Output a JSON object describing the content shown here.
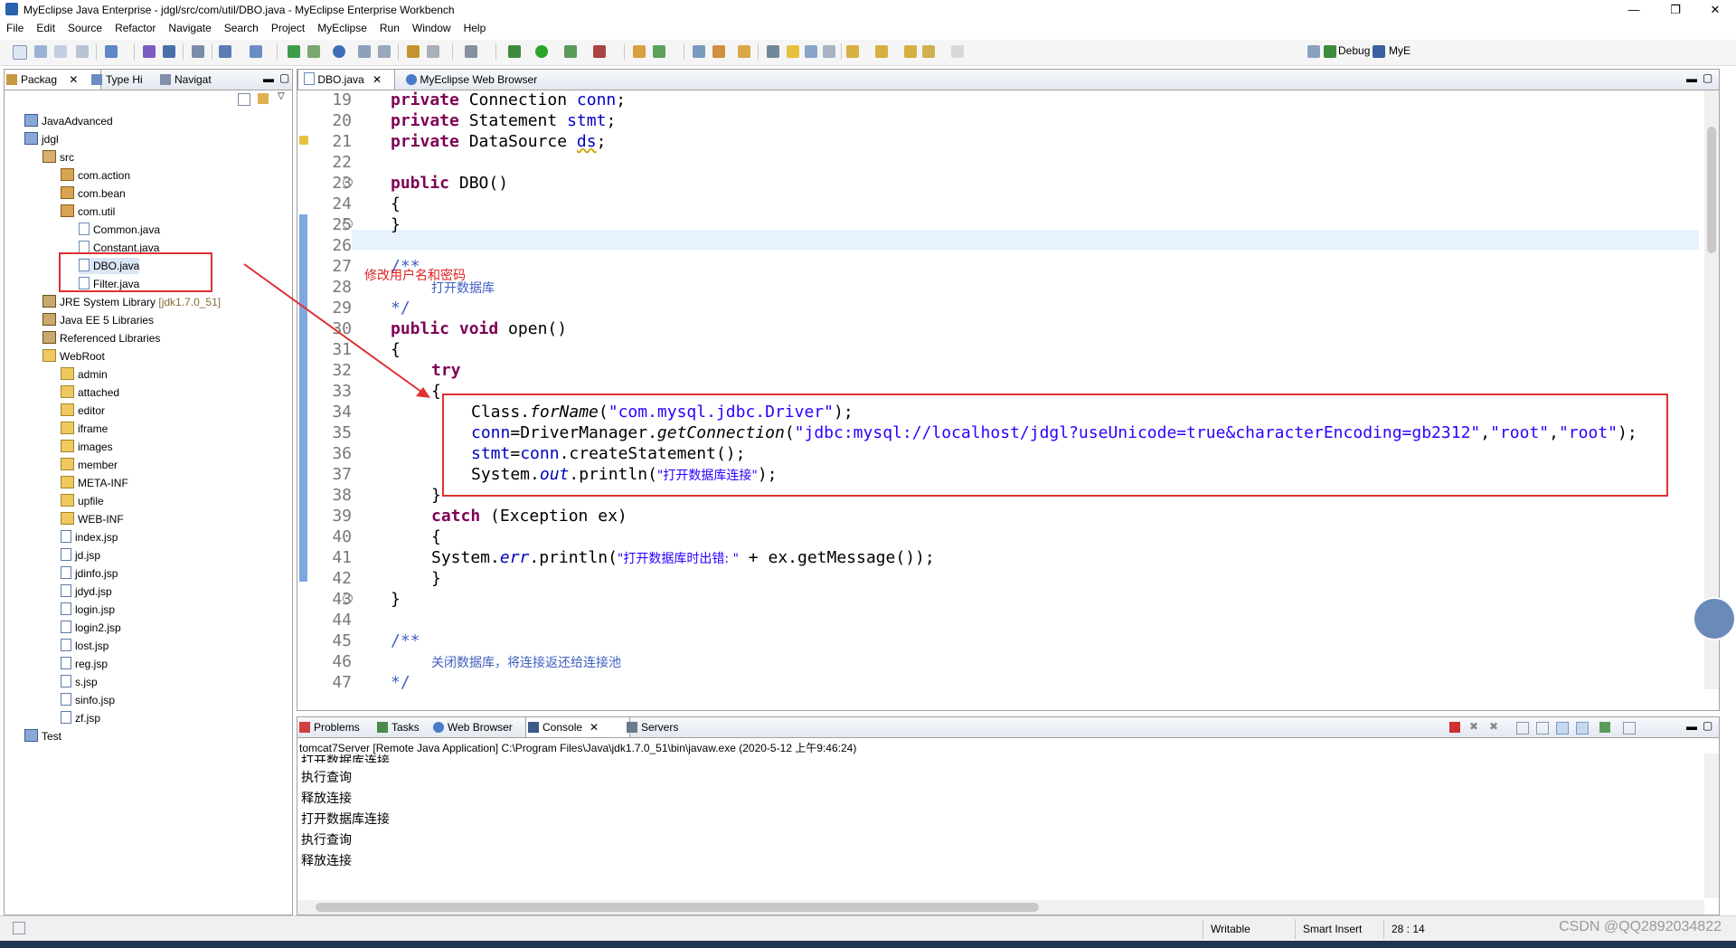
{
  "window": {
    "title": "MyEclipse Java Enterprise - jdgl/src/com/util/DBO.java - MyEclipse Enterprise Workbench",
    "minimize": "—",
    "maximize": "❐",
    "close": "✕"
  },
  "menu": [
    "File",
    "Edit",
    "Source",
    "Refactor",
    "Navigate",
    "Search",
    "Project",
    "MyEclipse",
    "Run",
    "Window",
    "Help"
  ],
  "perspectives": {
    "debug": "Debug",
    "myeclipse": "MyE"
  },
  "left_panel": {
    "tabs": [
      "Packag",
      "Type Hi",
      "Navigat"
    ],
    "tree": [
      {
        "label": "JavaAdvanced",
        "icon": "project"
      },
      {
        "label": "jdgl",
        "icon": "project"
      },
      {
        "label": "src",
        "icon": "src-folder"
      },
      {
        "label": "com.action",
        "icon": "package"
      },
      {
        "label": "com.bean",
        "icon": "package"
      },
      {
        "label": "com.util",
        "icon": "package"
      },
      {
        "label": "Common.java",
        "icon": "java-file"
      },
      {
        "label": "Constant.java",
        "icon": "java-file"
      },
      {
        "label": "DBO.java",
        "icon": "java-file"
      },
      {
        "label": "Filter.java",
        "icon": "java-file"
      },
      {
        "label": "JRE System Library",
        "decoration": "[jdk1.7.0_51]",
        "icon": "library"
      },
      {
        "label": "Java EE 5 Libraries",
        "icon": "library"
      },
      {
        "label": "Referenced Libraries",
        "icon": "library"
      },
      {
        "label": "WebRoot",
        "icon": "folder"
      },
      {
        "label": "admin",
        "icon": "folder"
      },
      {
        "label": "attached",
        "icon": "folder"
      },
      {
        "label": "editor",
        "icon": "folder"
      },
      {
        "label": "iframe",
        "icon": "folder"
      },
      {
        "label": "images",
        "icon": "folder"
      },
      {
        "label": "member",
        "icon": "folder"
      },
      {
        "label": "META-INF",
        "icon": "folder"
      },
      {
        "label": "upfile",
        "icon": "folder"
      },
      {
        "label": "WEB-INF",
        "icon": "folder"
      },
      {
        "label": "index.jsp",
        "icon": "jsp-file"
      },
      {
        "label": "jd.jsp",
        "icon": "jsp-file"
      },
      {
        "label": "jdinfo.jsp",
        "icon": "jsp-file"
      },
      {
        "label": "jdyd.jsp",
        "icon": "jsp-file"
      },
      {
        "label": "login.jsp",
        "icon": "jsp-file"
      },
      {
        "label": "login2.jsp",
        "icon": "jsp-file"
      },
      {
        "label": "lost.jsp",
        "icon": "jsp-file"
      },
      {
        "label": "reg.jsp",
        "icon": "jsp-file"
      },
      {
        "label": "s.jsp",
        "icon": "jsp-file"
      },
      {
        "label": "sinfo.jsp",
        "icon": "jsp-file"
      },
      {
        "label": "zf.jsp",
        "icon": "jsp-file"
      },
      {
        "label": "Test",
        "icon": "project"
      }
    ]
  },
  "editor": {
    "tabs": [
      "DBO.java",
      "MyEclipse Web Browser"
    ],
    "line_numbers": [
      "19",
      "20",
      "21",
      "22",
      "23",
      "24",
      "25",
      "26",
      "27",
      "28",
      "29",
      "30",
      "31",
      "32",
      "33",
      "34",
      "35",
      "36",
      "37",
      "38",
      "39",
      "40",
      "41",
      "42",
      "43",
      "44",
      "45",
      "46",
      "47"
    ],
    "code": {
      "l19_kw": "private",
      "l19_type": " Connection ",
      "l19_var": "conn",
      "l19_end": ";",
      "l20_kw": "private",
      "l20_type": " Statement ",
      "l20_var": "stmt",
      "l20_end": ";",
      "l21_kw": "private",
      "l21_type": " DataSource ",
      "l21_var": "ds",
      "l21_end": ";",
      "l23_kw": "public",
      "l23_rest": " DBO()",
      "l24": "{",
      "l25": "}",
      "l27": "/**",
      "l28": "打开数据库",
      "l29": "*/",
      "l30_kw1": "public",
      "l30_kw2": " void",
      "l30_rest": " open()",
      "l31": "{",
      "l32": "try",
      "l33": "{",
      "l34_a": "Class.",
      "l34_b": "forName",
      "l34_c": "(",
      "l34_str": "\"com.mysql.jdbc.Driver\"",
      "l34_d": ");",
      "l35_var": "conn",
      "l35_a": "=DriverManager.",
      "l35_b": "getConnection",
      "l35_c": "(",
      "l35_str": "\"jdbc:mysql://localhost/jdgl?useUnicode=true&characterEncoding=gb2312\"",
      "l35_d": ",",
      "l35_s2": "\"root\"",
      "l35_e": ",",
      "l35_s3": "\"root\"",
      "l35_f": ");",
      "l36_var": "stmt",
      "l36_a": "=",
      "l36_var2": "conn",
      "l36_b": ".createStatement();",
      "l37_a": "System.",
      "l37_b": "out",
      "l37_c": ".println(",
      "l37_str": "\"打开数据库连接\"",
      "l37_d": ");",
      "l38": "}",
      "l39_kw": "catch",
      "l39_rest": " (Exception ex)",
      "l40": "{",
      "l41_a": "System.",
      "l41_b": "err",
      "l41_c": ".println(",
      "l41_str": "\"打开数据库时出错: \"",
      "l41_d": " + ex.getMessage());",
      "l42": "}",
      "l43": "}",
      "l45": "/**",
      "l46": "关闭数据库，将连接返还给连接池",
      "l47": "*/"
    },
    "annotation": "修改用户名和密码"
  },
  "bottom_panel": {
    "tabs": [
      "Problems",
      "Tasks",
      "Web Browser",
      "Console",
      "Servers"
    ],
    "console_header": "tomcat7Server [Remote Java Application] C:\\Program Files\\Java\\jdk1.7.0_51\\bin\\javaw.exe (2020-5-12 上午9:46:24)",
    "lines": [
      "打开数据库连接",
      "执行查询",
      "释放连接",
      "打开数据库连接",
      "执行查询",
      "释放连接"
    ]
  },
  "status_bar": {
    "mode": "Writable",
    "insert": "Smart Insert",
    "position": "28 : 14"
  },
  "watermark": "CSDN @QQ2892034822",
  "colors": {
    "annotation_red": "#e03030",
    "keyword": "#7f0055",
    "field": "#0000c0",
    "string": "#2a00ff",
    "comment": "#3f5fbf"
  }
}
